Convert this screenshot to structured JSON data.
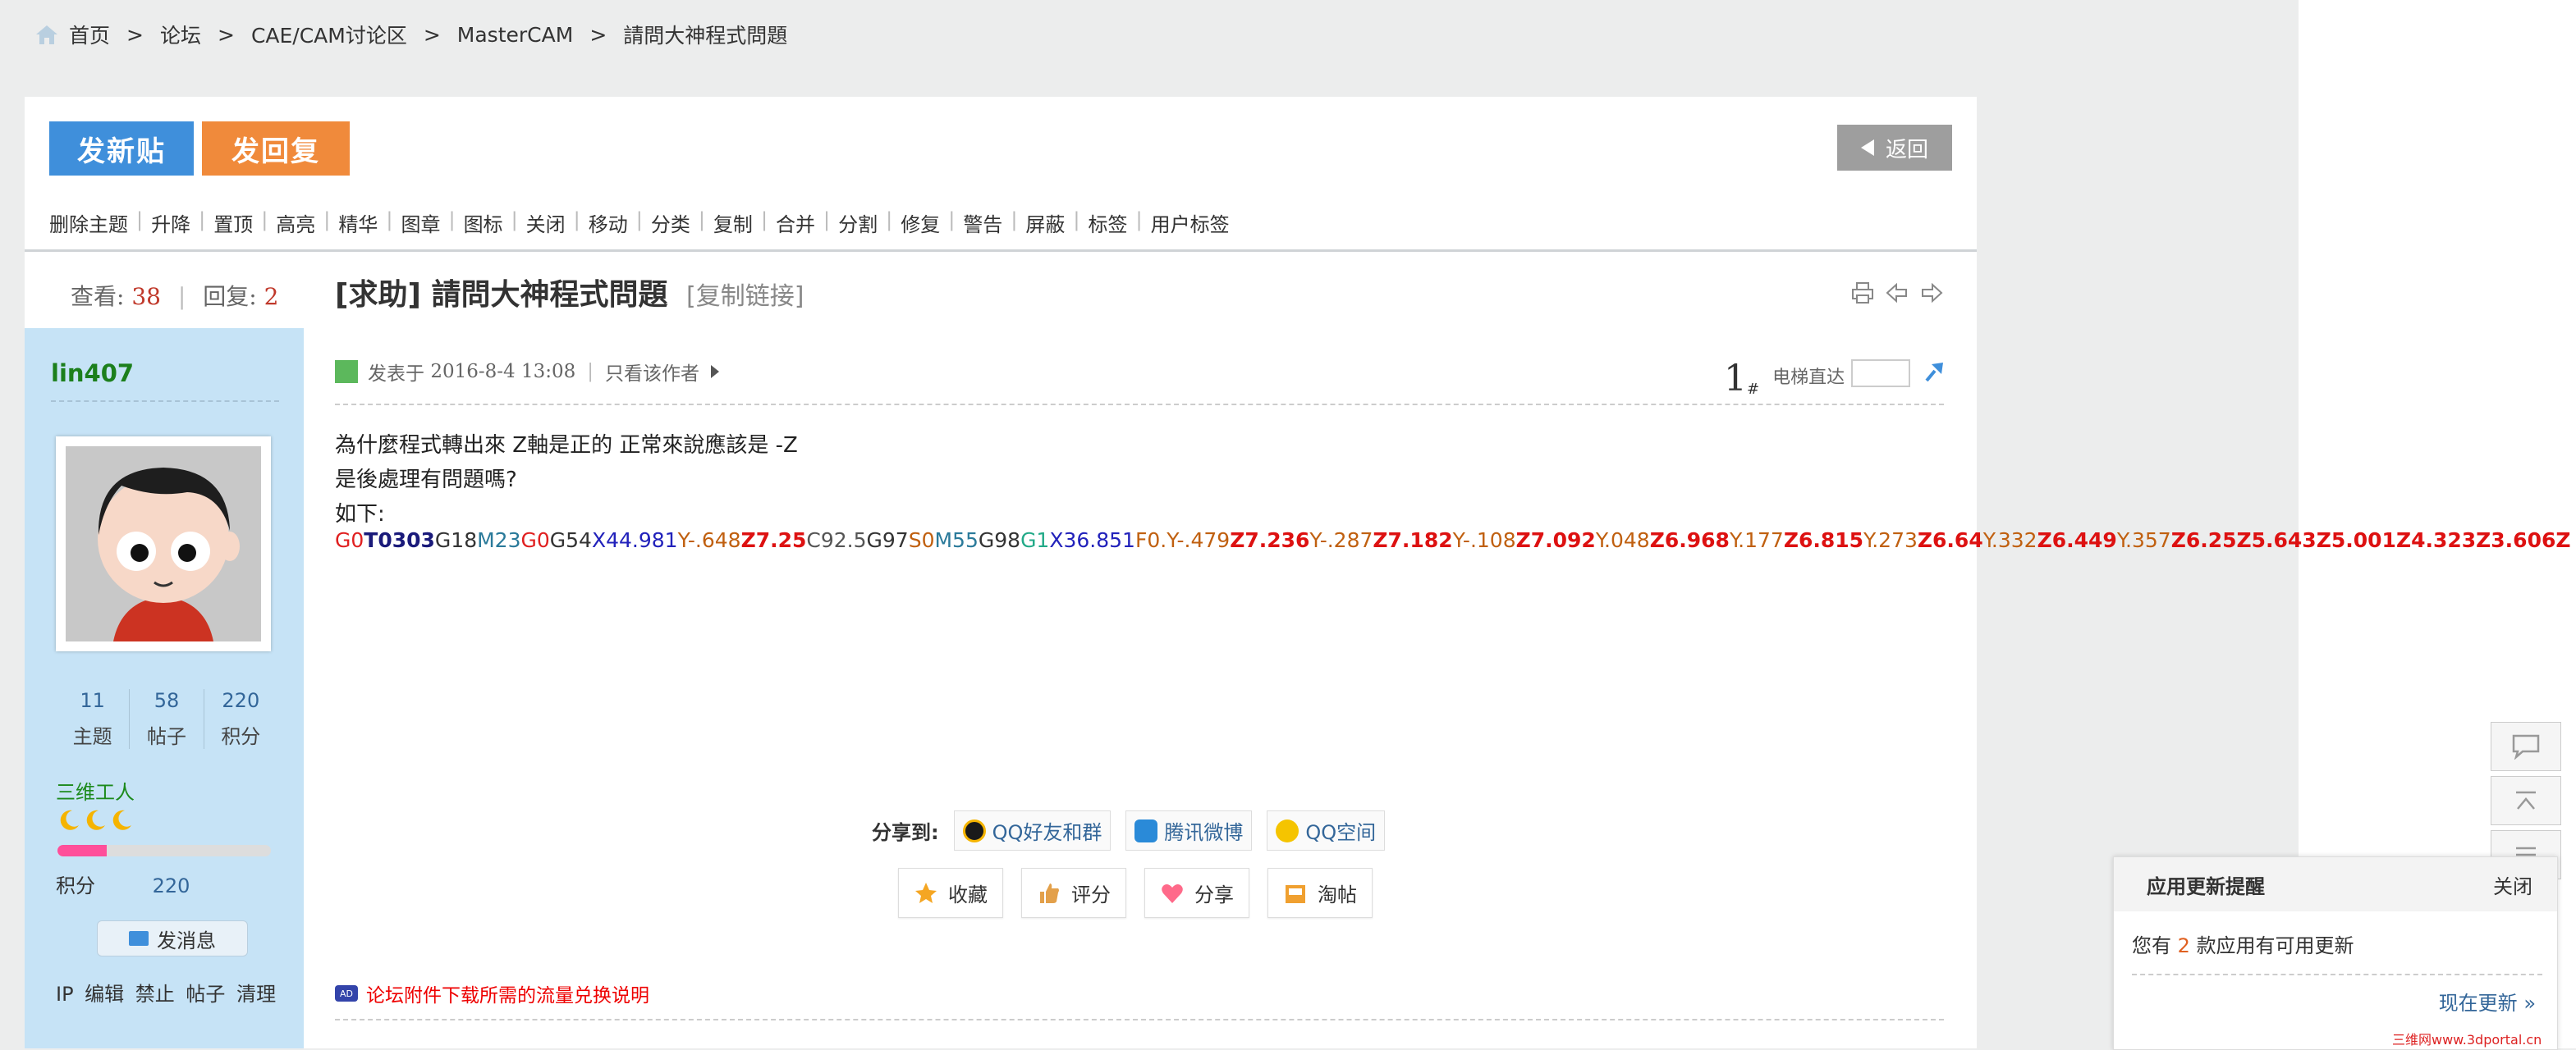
{
  "breadcrumb": {
    "items": [
      "首页",
      "论坛",
      "CAE/CAM讨论区",
      "MasterCAM",
      "請問大神程式問題"
    ],
    "sep": ">"
  },
  "toolbar": {
    "new_post": "发新贴",
    "reply": "发回复",
    "back": "返回"
  },
  "mod_actions": [
    "删除主题",
    "升降",
    "置顶",
    "高亮",
    "精华",
    "图章",
    "图标",
    "关闭",
    "移动",
    "分类",
    "复制",
    "合并",
    "分割",
    "修复",
    "警告",
    "屏蔽",
    "标签",
    "用户标签"
  ],
  "thread": {
    "views_label": "查看:",
    "views": "38",
    "replies_label": "回复:",
    "replies": "2",
    "prefix": "[求助]",
    "title": "請問大神程式問題",
    "copy_link": "[复制链接]"
  },
  "author": {
    "name": "lin407",
    "stats": [
      {
        "value": "11",
        "label": "主题"
      },
      {
        "value": "58",
        "label": "帖子"
      },
      {
        "value": "220",
        "label": "积分"
      }
    ],
    "rank": "三维工人",
    "rank_progress": 0.23,
    "score_label": "积分",
    "score": "220",
    "message_button": "发消息",
    "admin_links": "IP 编辑 禁止 帖子 清理"
  },
  "post": {
    "posted_label": "发表于",
    "posted_at": "2016-8-4 13:08",
    "only_author": "只看该作者",
    "floor": "1",
    "floor_suffix": "#",
    "jump_label": "电梯直达",
    "lines": [
      "為什麼程式轉出來 Z軸是正的 正常來說應該是 -Z",
      "是後處理有問題嗎?",
      "如下:"
    ],
    "gcode": [
      {
        "t": "G0",
        "c": "#e02020",
        "b": false
      },
      {
        "t": "T0303",
        "c": "#1a1a7a",
        "b": true
      },
      {
        "t": "G18",
        "c": "#333333",
        "b": false
      },
      {
        "t": "M23",
        "c": "#2a7a9a",
        "b": false
      },
      {
        "t": "G0",
        "c": "#e02020",
        "b": false
      },
      {
        "t": "G54",
        "c": "#333333",
        "b": false
      },
      {
        "t": "X44.981",
        "c": "#2222bb",
        "b": false
      },
      {
        "t": "Y-.648",
        "c": "#c06010",
        "b": false
      },
      {
        "t": "Z7.25",
        "c": "#dd1111",
        "b": true
      },
      {
        "t": "C92.5",
        "c": "#555555",
        "b": false
      },
      {
        "t": "G97",
        "c": "#333333",
        "b": false
      },
      {
        "t": "S0",
        "c": "#c06010",
        "b": false
      },
      {
        "t": "M55",
        "c": "#2a7a9a",
        "b": false
      },
      {
        "t": "G98",
        "c": "#333333",
        "b": false
      },
      {
        "t": "G1",
        "c": "#22aa88",
        "b": false
      },
      {
        "t": "X36.851",
        "c": "#2222bb",
        "b": false
      },
      {
        "t": "F0.",
        "c": "#c06010",
        "b": false
      },
      {
        "t": "Y-.479",
        "c": "#c06010",
        "b": false
      },
      {
        "t": "Z7.236",
        "c": "#dd1111",
        "b": true
      },
      {
        "t": "Y-.287",
        "c": "#c06010",
        "b": false
      },
      {
        "t": "Z7.182",
        "c": "#dd1111",
        "b": true
      },
      {
        "t": "Y-.108",
        "c": "#c06010",
        "b": false
      },
      {
        "t": "Z7.092",
        "c": "#dd1111",
        "b": true
      },
      {
        "t": "Y.048",
        "c": "#c06010",
        "b": false
      },
      {
        "t": "Z6.968",
        "c": "#dd1111",
        "b": true
      },
      {
        "t": "Y.177",
        "c": "#c06010",
        "b": false
      },
      {
        "t": "Z6.815",
        "c": "#dd1111",
        "b": true
      },
      {
        "t": "Y.273",
        "c": "#c06010",
        "b": false
      },
      {
        "t": "Z6.64",
        "c": "#dd1111",
        "b": true
      },
      {
        "t": "Y.332",
        "c": "#c06010",
        "b": false
      },
      {
        "t": "Z6.449",
        "c": "#dd1111",
        "b": true
      },
      {
        "t": "Y.357",
        "c": "#c06010",
        "b": false
      },
      {
        "t": "Z6.25",
        "c": "#dd1111",
        "b": true
      },
      {
        "t": "Z5.643",
        "c": "#dd1111",
        "b": true
      },
      {
        "t": "Z5.001",
        "c": "#dd1111",
        "b": true
      },
      {
        "t": "Z4.323",
        "c": "#dd1111",
        "b": true
      },
      {
        "t": "Z3.606",
        "c": "#dd1111",
        "b": true
      },
      {
        "t": "Z",
        "c": "#dd1111",
        "b": true
      }
    ]
  },
  "share": {
    "label": "分享到:",
    "targets": [
      "QQ好友和群",
      "腾讯微博",
      "QQ空间"
    ]
  },
  "actions": [
    "收藏",
    "评分",
    "分享",
    "淘帖"
  ],
  "notice": {
    "badge": "AD",
    "text": "论坛附件下载所需的流量兑换说明"
  },
  "update_popup": {
    "title": "应用更新提醒",
    "close": "关闭",
    "msg_prefix": "您有",
    "count": "2",
    "msg_suffix": "款应用有可用更新",
    "update_now": "现在更新 »"
  },
  "watermark": "三维网www.3dportal.cn",
  "colors": {
    "blue_btn": "#3f8fdb",
    "orange_btn": "#f08a3b",
    "sidebar_bg": "#c6e3f6",
    "accent_red": "#c0392b"
  }
}
